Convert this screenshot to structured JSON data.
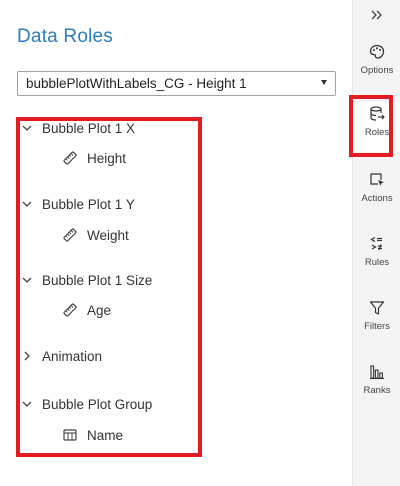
{
  "panel": {
    "title": "Data Roles",
    "dropdown": {
      "value": "bubblePlotWithLabels_CG - Height 1"
    }
  },
  "roles": [
    {
      "label": "Bubble Plot 1 X",
      "expanded": true,
      "item": {
        "label": "Height",
        "icon": "measure-icon"
      }
    },
    {
      "label": "Bubble Plot 1 Y",
      "expanded": true,
      "item": {
        "label": "Weight",
        "icon": "measure-icon"
      }
    },
    {
      "label": "Bubble Plot 1 Size",
      "expanded": true,
      "item": {
        "label": "Age",
        "icon": "measure-icon"
      }
    },
    {
      "label": "Animation",
      "expanded": false
    },
    {
      "label": "Bubble Plot Group",
      "expanded": true,
      "item": {
        "label": "Name",
        "icon": "category-icon"
      }
    }
  ],
  "rail": {
    "collapse_icon": "double-chevron-right-icon",
    "items": [
      {
        "label": "Options",
        "icon": "palette-icon"
      },
      {
        "label": "Roles",
        "icon": "database-arrow-icon",
        "active": true
      },
      {
        "label": "Actions",
        "icon": "cursor-box-icon"
      },
      {
        "label": "Rules",
        "icon": "rules-icon"
      },
      {
        "label": "Filters",
        "icon": "funnel-icon"
      },
      {
        "label": "Ranks",
        "icon": "bars-icon"
      }
    ]
  },
  "colors": {
    "title": "#2c7bbf",
    "highlight": "#e41b23",
    "rail_bg": "#f4f4f4"
  }
}
